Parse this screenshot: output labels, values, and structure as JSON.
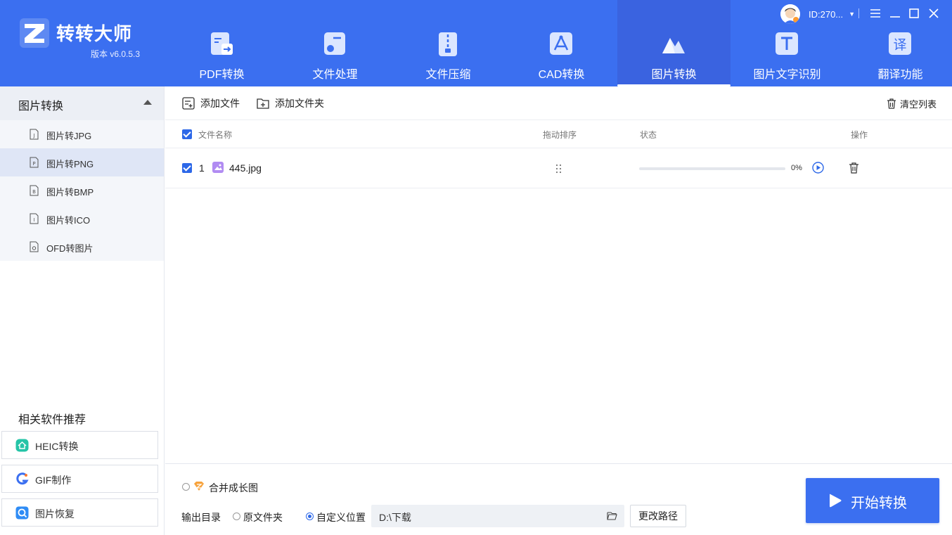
{
  "app": {
    "name": "转转大师",
    "version": "版本 v6.0.5.3",
    "user_id": "ID:270..."
  },
  "nav": [
    {
      "label": "PDF转换",
      "icon": "pdf-convert-icon"
    },
    {
      "label": "文件处理",
      "icon": "file-process-icon"
    },
    {
      "label": "文件压缩",
      "icon": "zip-icon"
    },
    {
      "label": "CAD转换",
      "icon": "cad-icon"
    },
    {
      "label": "图片转换",
      "icon": "image-icon",
      "active": true
    },
    {
      "label": "图片文字识别",
      "icon": "ocr-icon"
    },
    {
      "label": "翻译功能",
      "icon": "translate-icon"
    }
  ],
  "sidebar": {
    "section_title": "图片转换",
    "items": [
      {
        "label": "图片转JPG",
        "letter": "J"
      },
      {
        "label": "图片转PNG",
        "letter": "P",
        "selected": true
      },
      {
        "label": "图片转BMP",
        "letter": "B"
      },
      {
        "label": "图片转ICO",
        "letter": "I"
      },
      {
        "label": "OFD转图片",
        "letter": "O"
      }
    ],
    "recommend_title": "相关软件推荐",
    "recommend": [
      {
        "label": "HEIC转换"
      },
      {
        "label": "GIF制作"
      },
      {
        "label": "图片恢复"
      }
    ]
  },
  "toolbar": {
    "add_file": "添加文件",
    "add_folder": "添加文件夹",
    "clear_list": "清空列表"
  },
  "table": {
    "headers": {
      "name": "文件名称",
      "sort": "拖动排序",
      "status": "状态",
      "action": "操作"
    },
    "rows": [
      {
        "index": "1",
        "filename": "445.jpg",
        "progress_percent": 0,
        "progress_text": "0%"
      }
    ]
  },
  "bottom": {
    "merge_label": "合并成长图",
    "output_dir_label": "输出目录",
    "opt_original": "原文件夹",
    "opt_custom": "自定义位置",
    "path_value": "D:\\下载",
    "change_path": "更改路径",
    "start": "开始转换"
  },
  "colors": {
    "header_bg": "#3b6ff0",
    "accent": "#2d68e8"
  }
}
